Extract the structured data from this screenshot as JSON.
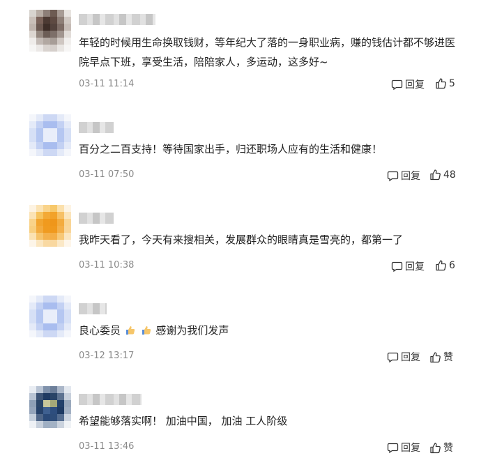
{
  "comments": [
    {
      "text": "年轻的时候用生命换取钱财，等年纪大了落的一身职业病，赚的钱估计都不够进医院早点下班，享受生活，陪陪家人，多运动，这多好~",
      "time": "03-11 11:14",
      "reply_label": "回复",
      "like_label": "5",
      "avatar_colors": [
        "#d8d4cf",
        "#b8ada5",
        "#8d7f78",
        "#6d5b52",
        "#a89c95",
        "#e8e4e0",
        "#c9bfb8",
        "#7a6259",
        "#4c3a33",
        "#5e4a42",
        "#8e7f77",
        "#d0c8c2",
        "#bfb4ad",
        "#6b5850",
        "#3e2e28",
        "#54433d",
        "#7d6c65",
        "#c6bcb6",
        "#dcd6d1",
        "#958880",
        "#6c5d56",
        "#7d6f69",
        "#a1958f",
        "#e2ddd9",
        "#efecea",
        "#c3bab5",
        "#b2a8a2",
        "#a79d97",
        "#cfc7c2",
        "#f1efed",
        "#f6f5f4",
        "#ebe8e6",
        "#d9d3cf",
        "#d5cfcb",
        "#e9e6e3",
        "#f7f6f5"
      ]
    },
    {
      "text": "百分之二百支持！等待国家出手，归还职场人应有的生活和健康！",
      "time": "03-11 07:50",
      "reply_label": "回复",
      "like_label": "48",
      "avatar_colors": [
        "#f4f6fb",
        "#e4eaf8",
        "#cdd8f4",
        "#cdd8f4",
        "#e4eaf8",
        "#f4f6fb",
        "#e4eaf8",
        "#c3d1f3",
        "#a9bdef",
        "#a9bdef",
        "#c3d1f3",
        "#e4eaf8",
        "#d6e0f6",
        "#b5c7f1",
        "#e9eefa",
        "#e9eefa",
        "#b5c7f1",
        "#d6e0f6",
        "#d6e0f6",
        "#b5c7f1",
        "#e9eefa",
        "#e9eefa",
        "#b5c7f1",
        "#d6e0f6",
        "#e4eaf8",
        "#c3d1f3",
        "#a9bdef",
        "#a9bdef",
        "#c3d1f3",
        "#e4eaf8",
        "#f4f6fb",
        "#e4eaf8",
        "#cdd8f4",
        "#cdd8f4",
        "#e4eaf8",
        "#f4f6fb"
      ]
    },
    {
      "text": "我昨天看了，今天有来搜相关，发展群众的眼睛真是雪亮的，都第一了",
      "time": "03-11 10:38",
      "reply_label": "回复",
      "like_label": "6",
      "avatar_colors": [
        "#fdf3e2",
        "#fbe3b5",
        "#f9d38a",
        "#f7c86a",
        "#fbe0ac",
        "#fdf4e4",
        "#fbe3b5",
        "#f6c35e",
        "#f3a936",
        "#f2a22a",
        "#f6c066",
        "#fbe5bc",
        "#f9d38a",
        "#f2a530",
        "#f09a1e",
        "#ef961a",
        "#f3ab3e",
        "#f9d595",
        "#f8cf80",
        "#f3ab3e",
        "#f09b20",
        "#f0991d",
        "#f4b04a",
        "#f9d69a",
        "#fbe2b2",
        "#f6c36a",
        "#f4b14c",
        "#f4ae46",
        "#f7c877",
        "#fbe6c0",
        "#fdf5e8",
        "#fbe6c0",
        "#f9d9a2",
        "#f9d8a0",
        "#fbe8c6",
        "#fef6ea"
      ]
    },
    {
      "text": "良心委员",
      "text_tail": "感谢为我们发声",
      "time": "03-12 13:17",
      "reply_label": "回复",
      "like_label": "赞",
      "avatar_colors": [
        "#f4f6fb",
        "#e4eaf8",
        "#cdd8f4",
        "#cdd8f4",
        "#e4eaf8",
        "#f4f6fb",
        "#e4eaf8",
        "#c3d1f3",
        "#a9bdef",
        "#a9bdef",
        "#c3d1f3",
        "#e4eaf8",
        "#d6e0f6",
        "#b5c7f1",
        "#e9eefa",
        "#e9eefa",
        "#b5c7f1",
        "#d6e0f6",
        "#d6e0f6",
        "#b5c7f1",
        "#e9eefa",
        "#e9eefa",
        "#b5c7f1",
        "#d6e0f6",
        "#e4eaf8",
        "#c3d1f3",
        "#a9bdef",
        "#a9bdef",
        "#c3d1f3",
        "#e4eaf8",
        "#f4f6fb",
        "#e4eaf8",
        "#cdd8f4",
        "#cdd8f4",
        "#e4eaf8",
        "#f4f6fb"
      ]
    },
    {
      "text": "希望能够落实啊！ 加油中国， 加油 工人阶级",
      "time": "03-11 13:46",
      "reply_label": "回复",
      "like_label": "赞",
      "avatar_colors": [
        "#e9edf3",
        "#b9c4d4",
        "#7f91ab",
        "#6d7f9a",
        "#aab6c8",
        "#e3e8ef",
        "#b9c4d4",
        "#3d5476",
        "#1f3a62",
        "#2a4467",
        "#5d7290",
        "#c8d0dc",
        "#8e9fb6",
        "#2a4568",
        "#c9c79a",
        "#a4a878",
        "#22406a",
        "#9aa9bd",
        "#95a5bb",
        "#26426a",
        "#3f6090",
        "#2e4e7e",
        "#1e3a63",
        "#a2b0c3",
        "#c5cfdc",
        "#4f6688",
        "#2b4a78",
        "#2e4d7a",
        "#556d90",
        "#cdd5e0",
        "#eef1f5",
        "#c7d0dc",
        "#9fafc3",
        "#a3b2c5",
        "#cbd3de",
        "#f0f3f6"
      ]
    }
  ]
}
